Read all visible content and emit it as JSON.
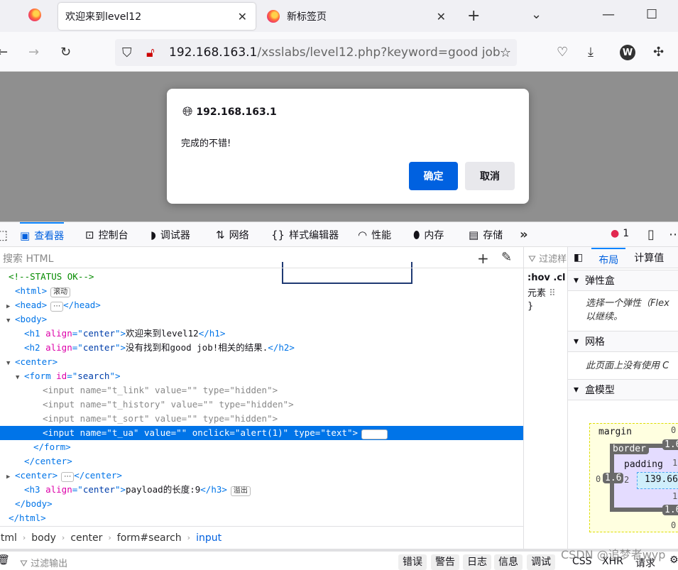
{
  "browser": {
    "tabs": [
      {
        "title": "欢迎来到level12",
        "active": true
      },
      {
        "title": "新标签页",
        "active": false
      }
    ],
    "url_host": "192.168.163.1",
    "url_rest": "/xsslabs/level12.php?keyword=good job!",
    "profile_initial": "W"
  },
  "dialog": {
    "origin": "192.168.163.1",
    "message": "完成的不错!",
    "ok": "确定",
    "cancel": "取消",
    "ok_color": "#0061e0"
  },
  "devtools": {
    "tabs": [
      {
        "icon": "inspector-icon",
        "glyph": "▣",
        "label": "查看器"
      },
      {
        "icon": "console-icon",
        "glyph": "⊡",
        "label": "控制台"
      },
      {
        "icon": "debugger-icon",
        "glyph": "◗",
        "label": "调试器"
      },
      {
        "icon": "network-icon",
        "glyph": "⇅",
        "label": "网络"
      },
      {
        "icon": "style-editor-icon",
        "glyph": "{}",
        "label": "样式编辑器"
      },
      {
        "icon": "performance-icon",
        "glyph": "◠",
        "label": "性能"
      },
      {
        "icon": "memory-icon",
        "glyph": "⬮",
        "label": "内存"
      },
      {
        "icon": "storage-icon",
        "glyph": "▤",
        "label": "存储"
      }
    ],
    "error_count": "1",
    "search_placeholder": "搜索 HTML",
    "markup": [
      {
        "indent": 0,
        "tw": "",
        "parts": [
          {
            "t": "<!--STATUS OK-->",
            "c": "cm"
          }
        ]
      },
      {
        "indent": 1,
        "tw": "",
        "parts": [
          {
            "t": "<html>",
            "c": "tag"
          }
        ],
        "badge": "滚动"
      },
      {
        "indent": 1,
        "tw": "▶",
        "parts": [
          {
            "t": "<head>",
            "c": "tag"
          },
          {
            "t": "⋯",
            "c": "badge"
          },
          {
            "t": "</head>",
            "c": "tag"
          }
        ]
      },
      {
        "indent": 1,
        "tw": "▼",
        "parts": [
          {
            "t": "<body>",
            "c": "tag"
          }
        ]
      },
      {
        "indent": 2,
        "tw": "",
        "parts": [
          {
            "t": "<h1 ",
            "c": "tag"
          },
          {
            "t": "align",
            "c": "an"
          },
          {
            "t": "=\"",
            "c": "tag"
          },
          {
            "t": "center",
            "c": "av"
          },
          {
            "t": "\">",
            "c": "tag"
          },
          {
            "t": "欢迎来到level12",
            "c": "txt"
          },
          {
            "t": "</h1>",
            "c": "tag"
          }
        ]
      },
      {
        "indent": 2,
        "tw": "",
        "parts": [
          {
            "t": "<h2 ",
            "c": "tag"
          },
          {
            "t": "align",
            "c": "an"
          },
          {
            "t": "=\"",
            "c": "tag"
          },
          {
            "t": "center",
            "c": "av"
          },
          {
            "t": "\">",
            "c": "tag"
          },
          {
            "t": "没有找到和good job!相关的结果.",
            "c": "txt"
          },
          {
            "t": "</h2>",
            "c": "tag"
          }
        ]
      },
      {
        "indent": 1,
        "tw": "▼",
        "parts": [
          {
            "t": "<center>",
            "c": "tag"
          }
        ]
      },
      {
        "indent": 2,
        "tw": "▼",
        "parts": [
          {
            "t": "<form ",
            "c": "tag"
          },
          {
            "t": "id",
            "c": "an"
          },
          {
            "t": "=\"",
            "c": "tag"
          },
          {
            "t": "search",
            "c": "av"
          },
          {
            "t": "\">",
            "c": "tag"
          }
        ]
      },
      {
        "indent": 4,
        "tw": "",
        "parts": [
          {
            "t": "<input name=\"t_link\" value=\"\" type=\"hidden\">",
            "c": "dim"
          }
        ]
      },
      {
        "indent": 4,
        "tw": "",
        "parts": [
          {
            "t": "<input name=\"t_history\" value=\"\" type=\"hidden\">",
            "c": "dim"
          }
        ]
      },
      {
        "indent": 4,
        "tw": "",
        "parts": [
          {
            "t": "<input name=\"t_sort\" value=\"\" type=\"hidden\">",
            "c": "dim"
          }
        ]
      },
      {
        "indent": 4,
        "tw": "",
        "sel": true,
        "parts": [
          {
            "t": "<input name=\"t_ua\" value=\"\" onclick=\"alert(1)\" type=\"text\">",
            "c": "tag"
          }
        ],
        "badge": "event"
      },
      {
        "indent": 3,
        "tw": "",
        "parts": [
          {
            "t": "</form>",
            "c": "tag"
          }
        ]
      },
      {
        "indent": 2,
        "tw": "",
        "parts": [
          {
            "t": "</center>",
            "c": "tag"
          }
        ]
      },
      {
        "indent": 1,
        "tw": "▶",
        "parts": [
          {
            "t": "<center>",
            "c": "tag"
          },
          {
            "t": "⋯",
            "c": "badge"
          },
          {
            "t": "</center>",
            "c": "tag"
          }
        ]
      },
      {
        "indent": 2,
        "tw": "",
        "parts": [
          {
            "t": "<h3 ",
            "c": "tag"
          },
          {
            "t": "align",
            "c": "an"
          },
          {
            "t": "=\"",
            "c": "tag"
          },
          {
            "t": "center",
            "c": "av"
          },
          {
            "t": "\">",
            "c": "tag"
          },
          {
            "t": "payload的长度:9",
            "c": "txt"
          },
          {
            "t": "</h3>",
            "c": "tag"
          }
        ],
        "badge": "溢出"
      },
      {
        "indent": 1,
        "tw": "",
        "parts": [
          {
            "t": "</body>",
            "c": "tag"
          }
        ]
      },
      {
        "indent": 0,
        "tw": "",
        "parts": [
          {
            "t": "</html>",
            "c": "tag"
          }
        ]
      }
    ],
    "breadcrumbs": [
      "html",
      "body",
      "center",
      "form#search",
      "input"
    ],
    "rules": {
      "filter": "过滤样",
      "hov": ":hov",
      ".cls": ".cl",
      "element": "元素",
      "brace": "}"
    },
    "layout": {
      "tabs": [
        "布局",
        "计算值"
      ],
      "flex_title": "弹性盒",
      "flex_note": "选择一个弹性（Flex",
      "flex_note2": "以继续。",
      "grid_title": "网格",
      "grid_note": "此页面上没有使用 C",
      "box_title": "盒模型",
      "box": {
        "margin_label": "margin",
        "border_label": "border",
        "padding_label": "padding",
        "margin_top": "0",
        "margin_left": "0",
        "margin_bottom": "0",
        "border_top": "1.6",
        "border_left": "1.6",
        "border_bottom": "1.6",
        "padding_top": "1",
        "padding_left": "2",
        "padding_bottom": "1",
        "content_width": "139.66"
      }
    },
    "console": {
      "filter_placeholder": "过滤输出",
      "levels": [
        "错误",
        "警告",
        "日志",
        "信息",
        "调试"
      ],
      "extra": [
        "CSS",
        "XHR",
        "请求"
      ]
    }
  },
  "watermark": "CSDN @追梦者wyp"
}
